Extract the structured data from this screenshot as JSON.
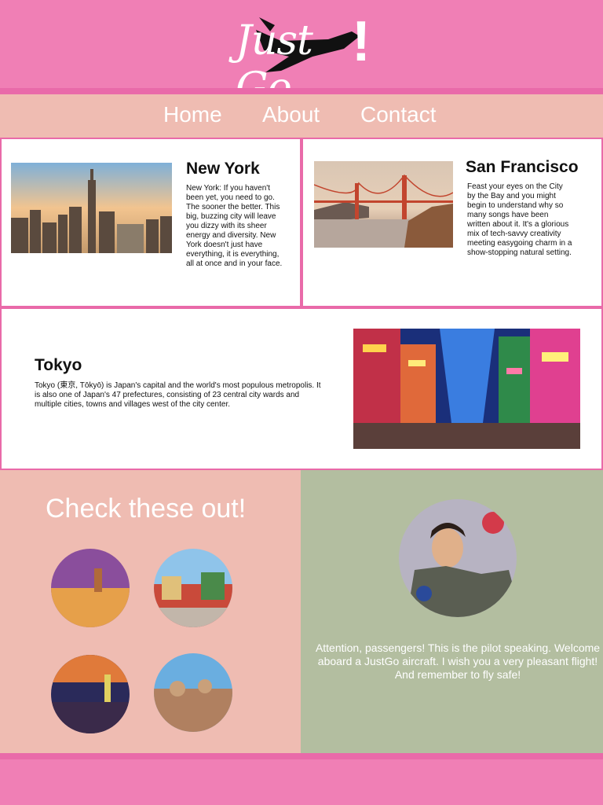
{
  "brand": {
    "logo_text": "Just Go",
    "logo_bang": "!"
  },
  "nav": {
    "items": [
      {
        "label": "Home"
      },
      {
        "label": "About"
      },
      {
        "label": "Contact"
      }
    ]
  },
  "destinations": [
    {
      "title": "New York",
      "text": "New York: If you haven't been yet, you need to go. The sooner the better. This big, buzzing city will leave you dizzy with its sheer energy and diversity. New York doesn't just have everything, it is everything, all at once and in your face."
    },
    {
      "title": "San Francisco",
      "text": "Feast your eyes on the City by the Bay and you might begin to understand why so many songs have been written about it. It's a glorious mix of tech-savvy creativity meeting easygoing charm in a show-stopping natural setting."
    },
    {
      "title": "Tokyo",
      "text": "Tokyo (東京, Tōkyō) is Japan's capital and the world's most populous metropolis. It is also one of Japan's 47 prefectures, consisting of 23 central city wards and multiple cities, towns and villages west of the city center."
    }
  ],
  "check": {
    "title": "Check these out!"
  },
  "pilot": {
    "message": "Attention, passengers! This is the pilot speaking. Welcome aboard a JustGo aircraft. I wish you a very pleasant flight! And remember to fly safe!"
  }
}
